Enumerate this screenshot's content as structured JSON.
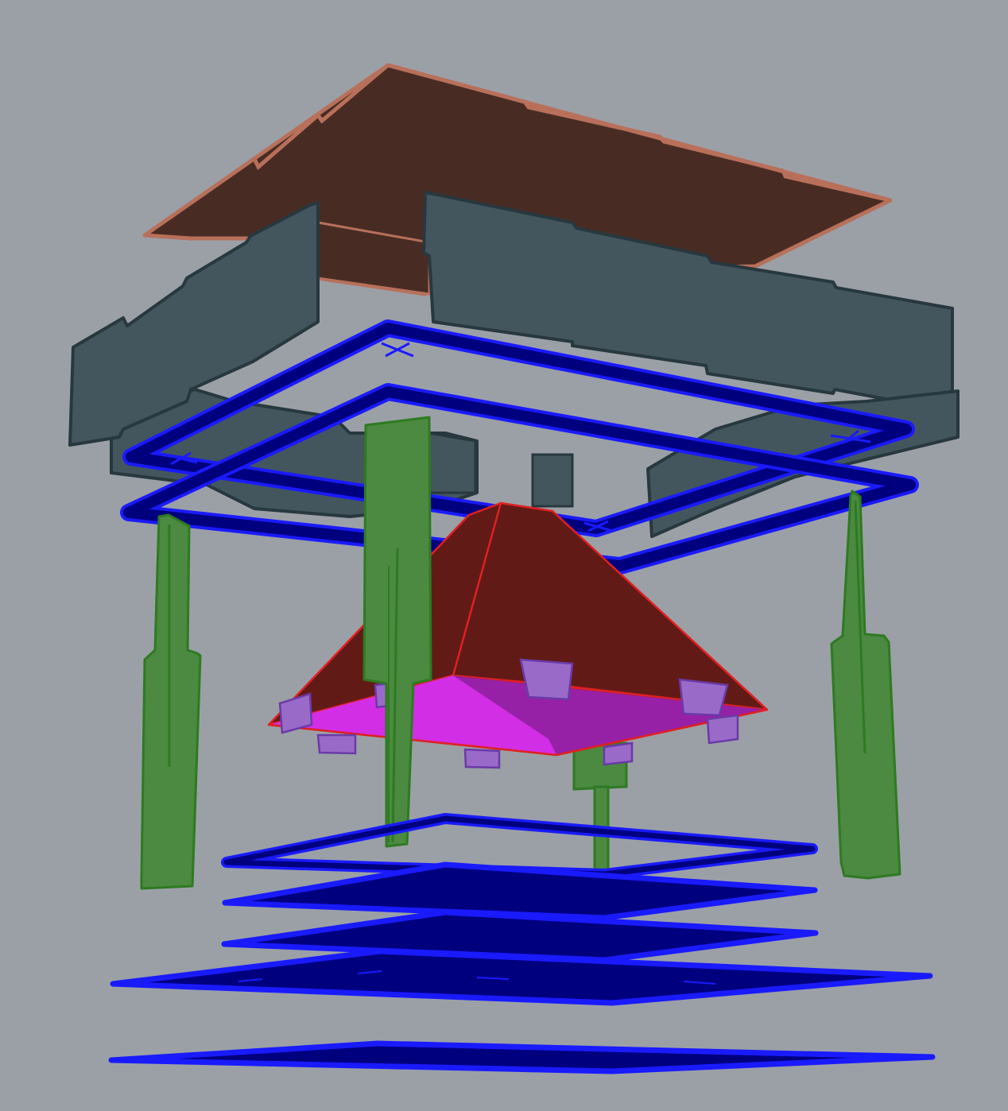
{
  "scene": {
    "description_visible_text": "",
    "colors": {
      "background": "#9ba0a6",
      "top_panel": "#482c24",
      "top_panel_edge": "#b8705a",
      "wall_panel": "#43565d",
      "wall_panel_edge": "#27383e",
      "blue_frame": "#00007f",
      "blue_frame_edge": "#1a1aff",
      "green_leg": "#4b8a40",
      "green_leg_edge": "#2e7a22",
      "hood_top": "#621a17",
      "hood_edge": "#e02020",
      "hood_bottom": "#d22ee6",
      "hood_side": "#8d1f9a",
      "tab": "#9a6ac8",
      "tab_edge": "#6a3aa8"
    },
    "components": [
      {
        "id": "top-panel",
        "material": "brown-board"
      },
      {
        "id": "wall-panels",
        "material": "slate-board"
      },
      {
        "id": "upper-blue-frames",
        "count": 2
      },
      {
        "id": "green-legs",
        "count": 5
      },
      {
        "id": "hood",
        "material": "red-pyramid"
      },
      {
        "id": "hood-tabs",
        "count": 8
      },
      {
        "id": "lower-blue-frame",
        "count": 1
      },
      {
        "id": "blue-plates",
        "count": 4
      }
    ]
  }
}
